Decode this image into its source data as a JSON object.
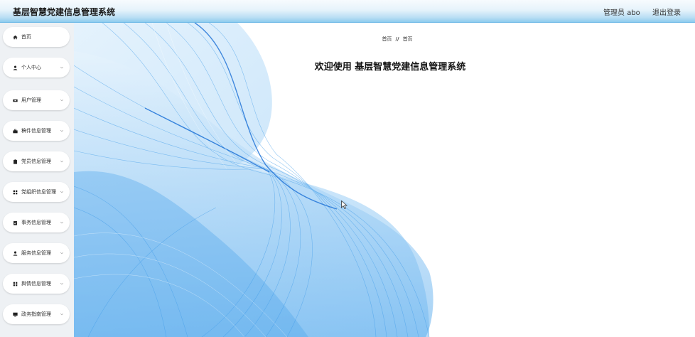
{
  "header": {
    "app_title": "基层智慧党建信息管理系统",
    "user_label": "管理员 abo",
    "logout_label": "退出登录"
  },
  "sidebar": {
    "items": [
      {
        "label": "首页",
        "icon": "home-icon",
        "has_submenu": false
      },
      {
        "label": "个人中心",
        "icon": "user-icon",
        "has_submenu": true
      },
      {
        "label": "用户管理",
        "icon": "users-icon",
        "has_submenu": true
      },
      {
        "label": "稿件信息管理",
        "icon": "briefcase-icon",
        "has_submenu": true
      },
      {
        "label": "党员信息管理",
        "icon": "clipboard-icon",
        "has_submenu": true
      },
      {
        "label": "党组织信息管理",
        "icon": "grid-icon",
        "has_submenu": true
      },
      {
        "label": "事务信息管理",
        "icon": "task-icon",
        "has_submenu": true
      },
      {
        "label": "服务信息管理",
        "icon": "user-icon",
        "has_submenu": true
      },
      {
        "label": "舆情信息管理",
        "icon": "grid-icon",
        "has_submenu": true
      },
      {
        "label": "政务指南管理",
        "icon": "monitor-icon",
        "has_submenu": true
      }
    ]
  },
  "breadcrumb": {
    "items": [
      "首页",
      "首页"
    ],
    "separator": "//"
  },
  "main": {
    "welcome_text": "欢迎使用 基层智慧党建信息管理系统"
  },
  "colors": {
    "accent": "#2e8fe8",
    "header_gradient_bottom": "#8ccbee",
    "sidebar_bg": "#eef1f4"
  }
}
